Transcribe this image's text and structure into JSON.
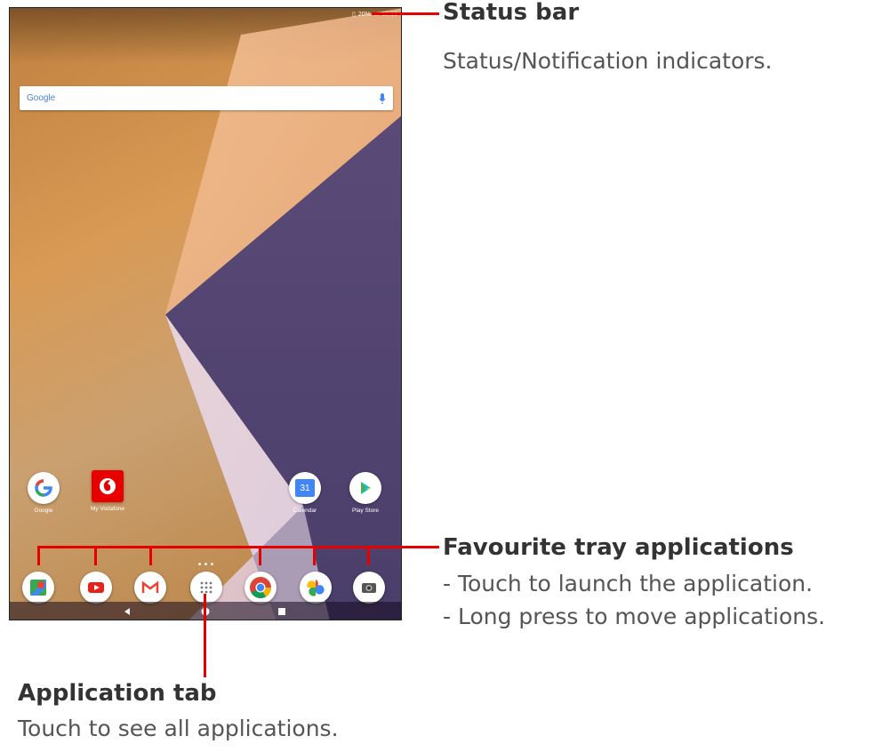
{
  "status_bar": {
    "battery": "20%",
    "time": "15:16"
  },
  "search": {
    "logo_text": "Google"
  },
  "home_apps": [
    {
      "label": "Google",
      "icon": "google-icon"
    },
    {
      "label": "My Vodafone",
      "icon": "vodafone-icon"
    },
    {
      "label": "Calendar",
      "icon": "calendar-icon",
      "badge": "31"
    },
    {
      "label": "Play Store",
      "icon": "play-store-icon"
    }
  ],
  "favourite_tray": [
    {
      "icon": "maps-icon"
    },
    {
      "icon": "youtube-icon"
    },
    {
      "icon": "gmail-icon"
    },
    {
      "icon": "app-drawer-icon"
    },
    {
      "icon": "chrome-icon"
    },
    {
      "icon": "photos-icon"
    },
    {
      "icon": "camera-icon"
    }
  ],
  "colors": {
    "accent_red": "#e60000",
    "heading": "#333333",
    "body_text": "#555555"
  },
  "callouts": {
    "status_bar": {
      "title": "Status bar",
      "text": "Status/Notification indicators."
    },
    "favourite_tray": {
      "title": "Favourite tray applications",
      "line1": "- Touch to launch the application.",
      "line2": "- Long press to move applications."
    },
    "application_tab": {
      "title": "Application tab",
      "text": "Touch to see all applications."
    }
  }
}
